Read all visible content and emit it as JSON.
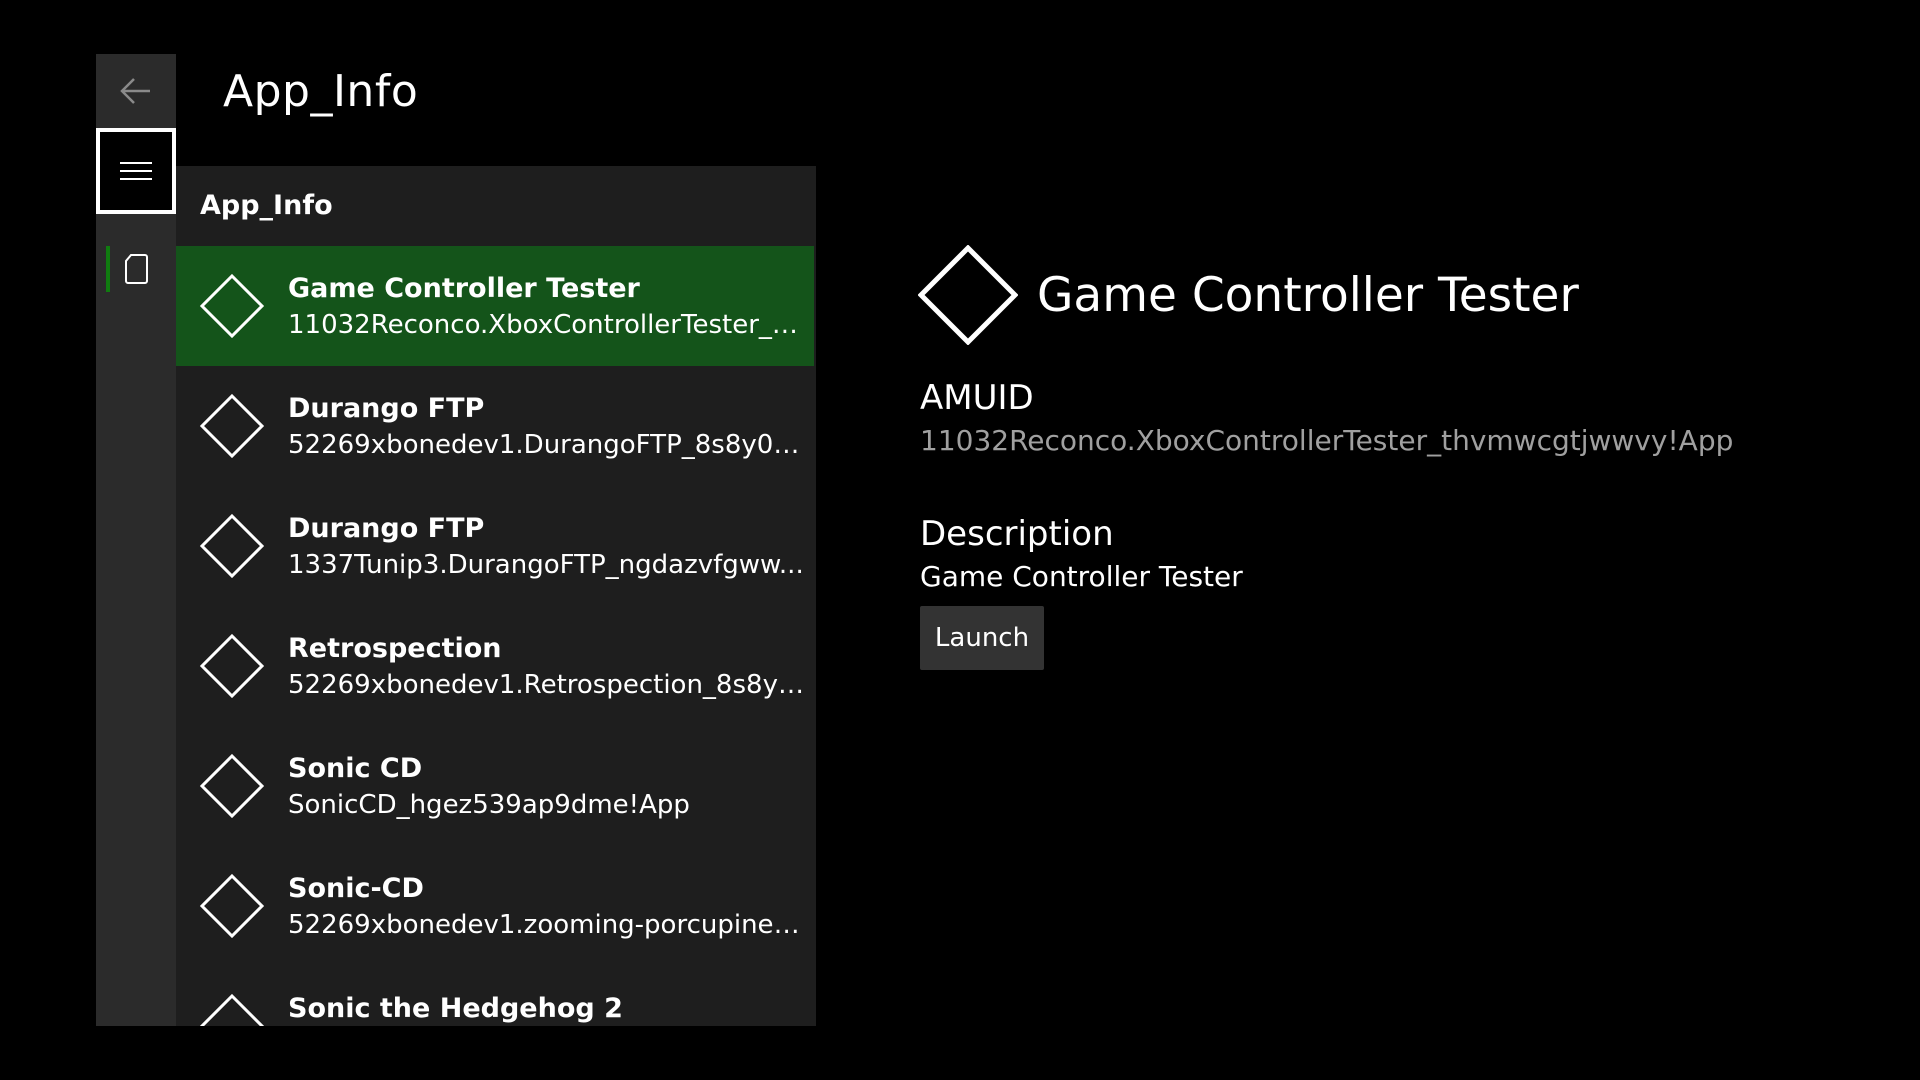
{
  "page": {
    "title": "App_Info"
  },
  "nav": {
    "back_icon": "arrow-left-icon",
    "menu_icon": "hamburger-menu-icon",
    "items": [
      {
        "icon": "device-icon",
        "selected": true
      }
    ],
    "accent_color": "#107c10"
  },
  "pane": {
    "header": "App_Info",
    "selected_color": "#14541a",
    "items": [
      {
        "title": "Game Controller Tester",
        "subtitle": "11032Reconco.XboxControllerTester_th...",
        "icon": "diamond-app-icon",
        "selected": true
      },
      {
        "title": "Durango FTP",
        "subtitle": "52269xbonedev1.DurangoFTP_8s8y06a...",
        "icon": "diamond-app-icon",
        "selected": false
      },
      {
        "title": "Durango FTP",
        "subtitle": "1337Tunip3.DurangoFTP_ngdazvfgww...",
        "icon": "diamond-app-icon",
        "selected": false
      },
      {
        "title": "Retrospection",
        "subtitle": "52269xbonedev1.Retrospection_8s8y0...",
        "icon": "diamond-app-icon",
        "selected": false
      },
      {
        "title": "Sonic CD",
        "subtitle": "SonicCD_hgez539ap9dme!App",
        "icon": "diamond-app-icon",
        "selected": false
      },
      {
        "title": "Sonic-CD",
        "subtitle": "52269xbonedev1.zooming-porcupine_...",
        "icon": "diamond-app-icon",
        "selected": false
      },
      {
        "title": "Sonic the Hedgehog 2",
        "subtitle": "",
        "icon": "diamond-app-icon",
        "selected": false
      }
    ]
  },
  "detail": {
    "icon": "diamond-app-icon",
    "title": "Game Controller Tester",
    "amuid_label": "AMUID",
    "amuid_value": "11032Reconco.XboxControllerTester_thvmwcgtjwwvy!App",
    "description_label": "Description",
    "description_value": "Game Controller Tester",
    "launch_label": "Launch"
  }
}
